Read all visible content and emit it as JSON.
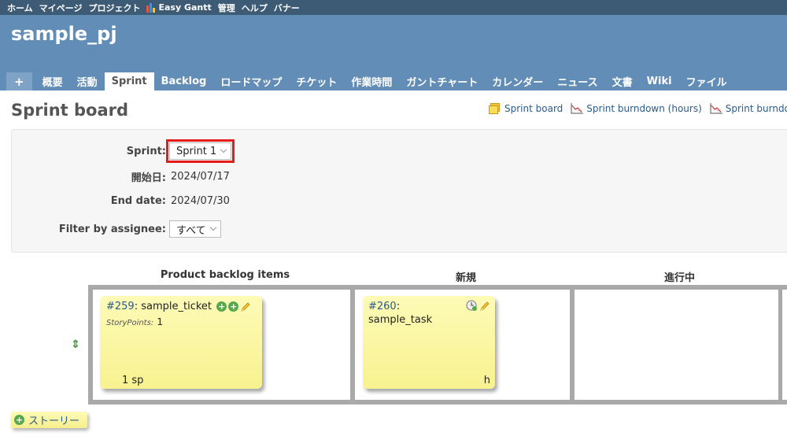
{
  "topbar": {
    "items": [
      "ホーム",
      "マイページ",
      "プロジェクト",
      "Easy Gantt",
      "管理",
      "ヘルプ",
      "バナー"
    ]
  },
  "project": {
    "title": "sample_pj"
  },
  "tabs": {
    "plus": "+",
    "items": [
      "概要",
      "活動",
      "Sprint",
      "Backlog",
      "ロードマップ",
      "チケット",
      "作業時間",
      "ガントチャート",
      "カレンダー",
      "ニュース",
      "文書",
      "Wiki",
      "ファイル"
    ],
    "active": "Sprint"
  },
  "page": {
    "title": "Sprint board"
  },
  "toolbar_links": [
    "Sprint board",
    "Sprint burndown (hours)",
    "Sprint burndo"
  ],
  "filters": {
    "sprint_label": "Sprint:",
    "sprint_value": "Sprint 1",
    "start_label": "開始日:",
    "start_value": "2024/07/17",
    "end_label": "End date:",
    "end_value": "2024/07/30",
    "assignee_label": "Filter by assignee:",
    "assignee_value": "すべて"
  },
  "board": {
    "columns": [
      "Product backlog items",
      "新規",
      "進行中"
    ],
    "story": {
      "id": "#259",
      "title": "sample_ticket",
      "points_label": "StoryPoints:",
      "points_value": "1",
      "sp_footer": "1 sp"
    },
    "task": {
      "id": "#260",
      "title": "sample_task",
      "footer": "h"
    }
  },
  "story_button": {
    "label": "ストーリー"
  },
  "colors": {
    "header": "#628db6",
    "topbar": "#3e5b76",
    "note": "#f8f290",
    "highlight": "#e41c1c"
  }
}
